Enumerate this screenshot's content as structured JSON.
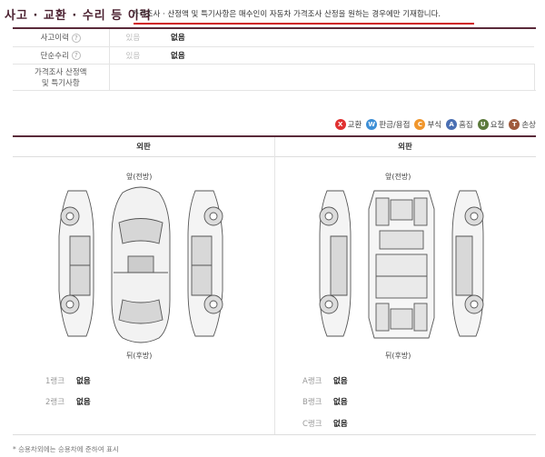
{
  "header": {
    "title": "사고 · 교환 · 수리 등 이력",
    "note": "가격조사 · 산정액 및 특기사항은 매수인이 자동차 가격조사 산정을 원하는 경우에만 기재합니다.",
    "accent_color": "#d0121b"
  },
  "info_rows": [
    {
      "label": "사고이력",
      "help_icon": "question-icon",
      "check": "있음",
      "value": "없음"
    },
    {
      "label": "단순수리",
      "help_icon": "question-icon",
      "check": "있음",
      "value": "없음"
    },
    {
      "label_line1": "가격조사 산정액",
      "label_line2": "및 특기사항"
    }
  ],
  "legend": [
    {
      "code": "X",
      "label": "교환",
      "color": "#e03131"
    },
    {
      "code": "W",
      "label": "판금/용접",
      "color": "#3d8fd6"
    },
    {
      "code": "C",
      "label": "부식",
      "color": "#f0962c"
    },
    {
      "code": "A",
      "label": "흠집",
      "color": "#4a6fb3"
    },
    {
      "code": "U",
      "label": "요철",
      "color": "#5c7a3c"
    },
    {
      "code": "T",
      "label": "손상",
      "color": "#a05a3c"
    }
  ],
  "exterior": {
    "left_header": "외판",
    "right_header": "외판",
    "left_front": "앞(전방)",
    "left_rear": "뒤(후방)",
    "right_front": "앞(전방)",
    "right_rear": "뒤(후방)"
  },
  "ranks_left": [
    {
      "key": "1랭크",
      "value": "없음"
    },
    {
      "key": "2랭크",
      "value": "없음"
    }
  ],
  "ranks_right": [
    {
      "key": "A랭크",
      "value": "없음"
    },
    {
      "key": "B랭크",
      "value": "없음"
    },
    {
      "key": "C랭크",
      "value": "없음"
    }
  ],
  "footnote": "* 승용차외에는 승용차에 준하여 표시"
}
